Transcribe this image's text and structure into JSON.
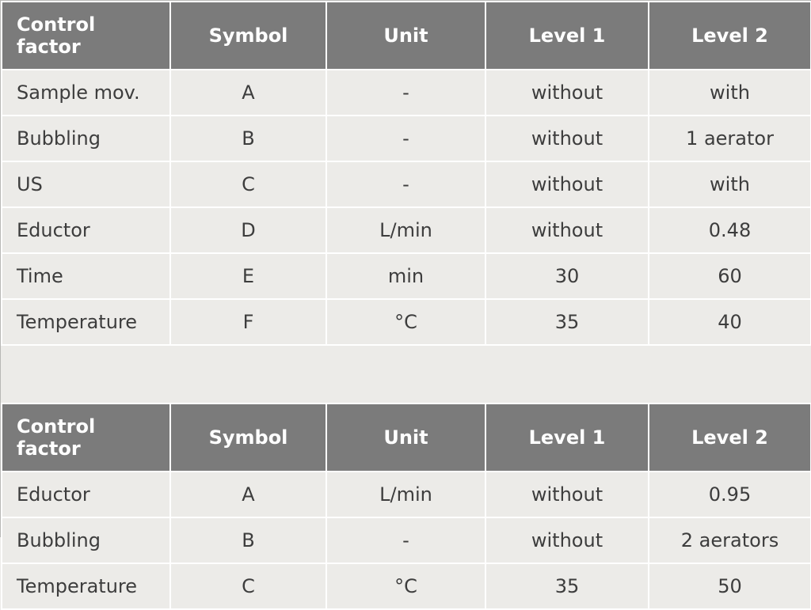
{
  "headers": {
    "factor": "Control factor",
    "symbol": "Symbol",
    "unit": "Unit",
    "level1": "Level 1",
    "level2": "Level 2"
  },
  "table1": {
    "rows": [
      {
        "factor": "Sample mov.",
        "symbol": "A",
        "unit": "-",
        "level1": "without",
        "level2": "with"
      },
      {
        "factor": "Bubbling",
        "symbol": "B",
        "unit": "-",
        "level1": "without",
        "level2": "1 aerator"
      },
      {
        "factor": "US",
        "symbol": "C",
        "unit": "-",
        "level1": "without",
        "level2": "with"
      },
      {
        "factor": "Eductor",
        "symbol": "D",
        "unit": "L/min",
        "level1": "without",
        "level2": "0.48"
      },
      {
        "factor": "Time",
        "symbol": "E",
        "unit": "min",
        "level1": "30",
        "level2": "60"
      },
      {
        "factor": "Temperature",
        "symbol": "F",
        "unit": "°C",
        "level1": "35",
        "level2": "40"
      }
    ]
  },
  "table2": {
    "rows": [
      {
        "factor": "Eductor",
        "symbol": "A",
        "unit": "L/min",
        "level1": "without",
        "level2": "0.95"
      },
      {
        "factor": "Bubbling",
        "symbol": "B",
        "unit": "-",
        "level1": "without",
        "level2": "2 aerators"
      },
      {
        "factor": "Temperature",
        "symbol": "C",
        "unit": "°C",
        "level1": "35",
        "level2": "50"
      }
    ]
  }
}
